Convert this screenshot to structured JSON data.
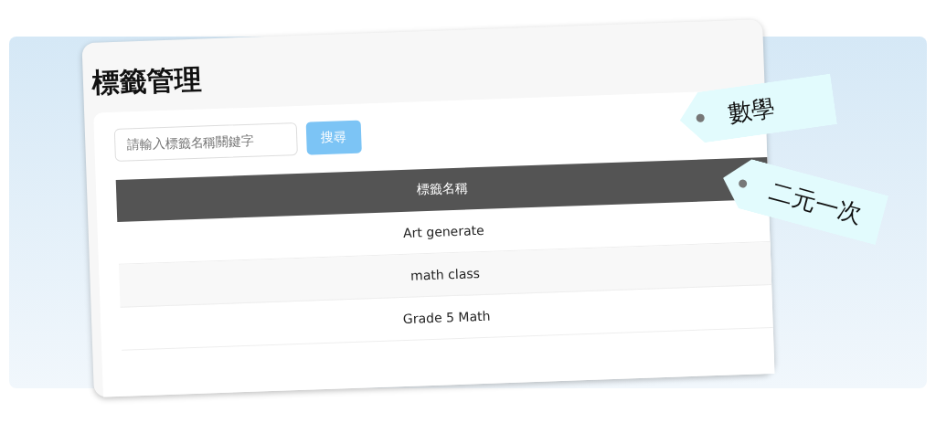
{
  "page": {
    "title": "標籤管理"
  },
  "search": {
    "placeholder": "請輸入標籤名稱關鍵字",
    "button": "搜尋"
  },
  "table": {
    "columns": [
      "標籤名稱"
    ],
    "rows": [
      {
        "cells": [
          "Art generate"
        ]
      },
      {
        "cells": [
          "math class"
        ]
      },
      {
        "cells": [
          "Grade 5 Math"
        ]
      }
    ]
  },
  "tags": [
    {
      "label": "數學"
    },
    {
      "label": "二元一次"
    }
  ]
}
